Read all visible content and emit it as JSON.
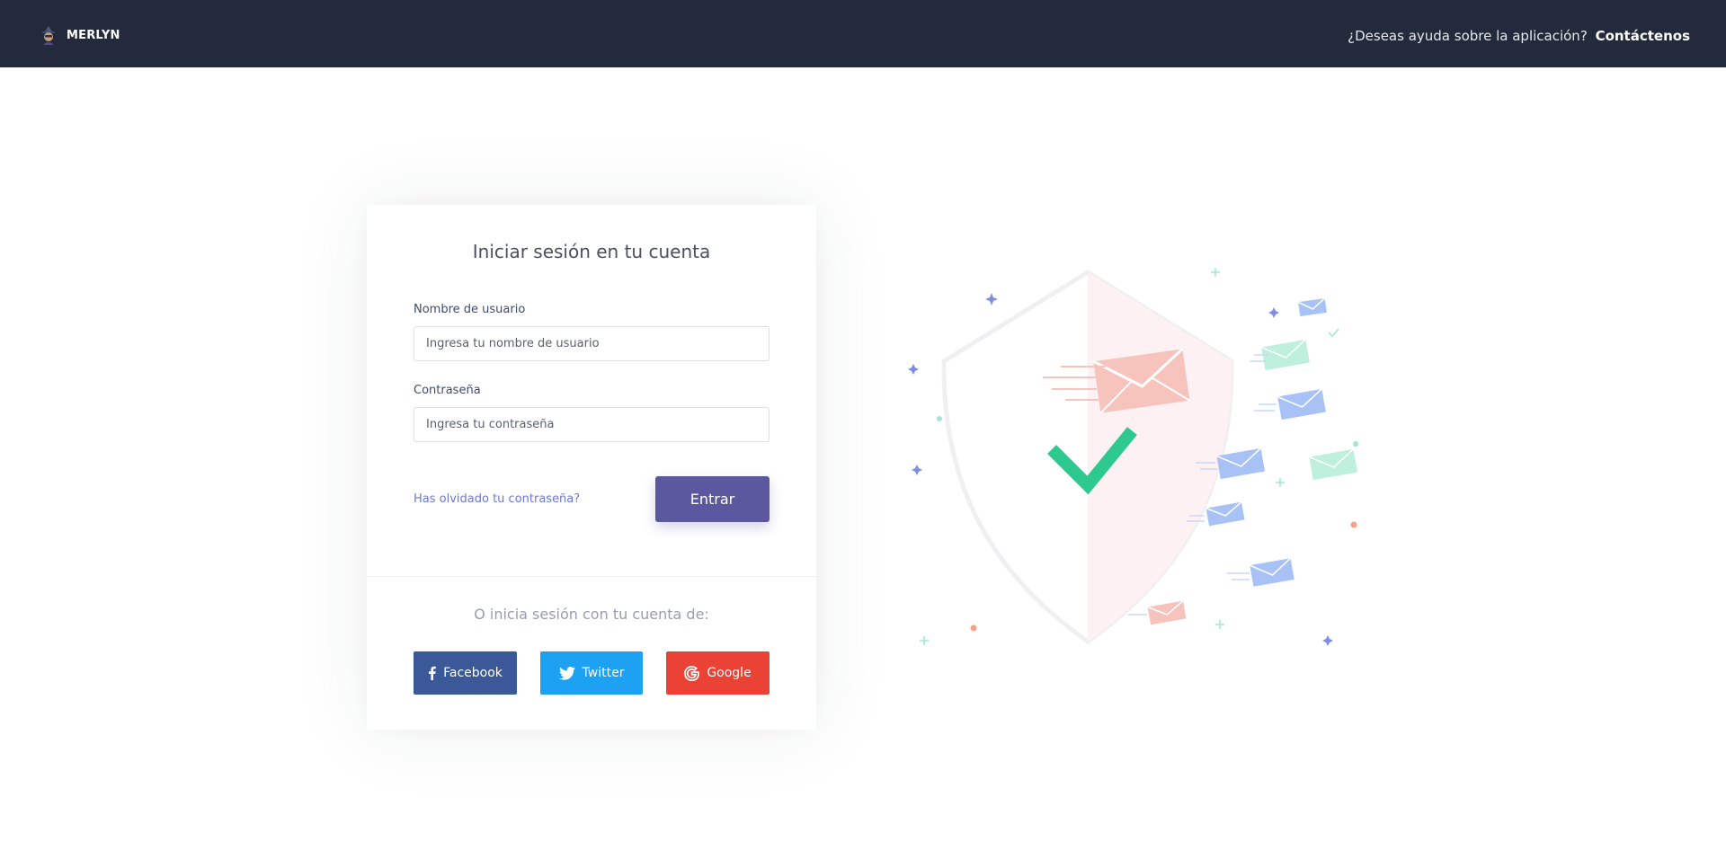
{
  "header": {
    "brand": "MERLYN",
    "help_question": "¿Deseas ayuda sobre la aplicación?",
    "help_link": "Contáctenos"
  },
  "login": {
    "title": "Iniciar sesión en tu cuenta",
    "username_label": "Nombre de usuario",
    "username_placeholder": "Ingresa tu nombre de usuario",
    "password_label": "Contraseña",
    "password_placeholder": "Ingresa tu contraseña",
    "forgot_link": "Has olvidado tu contraseña?",
    "submit_label": "Entrar",
    "alt_login_text": "O inicia sesión con tu cuenta de:",
    "social": {
      "facebook": "Facebook",
      "twitter": "Twitter",
      "google": "Google"
    }
  },
  "colors": {
    "topbar": "#232a3b",
    "primary": "#5b589f",
    "link": "#6a78d8",
    "facebook": "#3b5998",
    "twitter": "#1da1f2",
    "google": "#ea4335",
    "check": "#2ec98f"
  },
  "icons": [
    "merlyn-logo-icon",
    "facebook-icon",
    "twitter-icon",
    "google-icon",
    "shield-illustration",
    "checkmark-icon",
    "envelope-icon"
  ]
}
